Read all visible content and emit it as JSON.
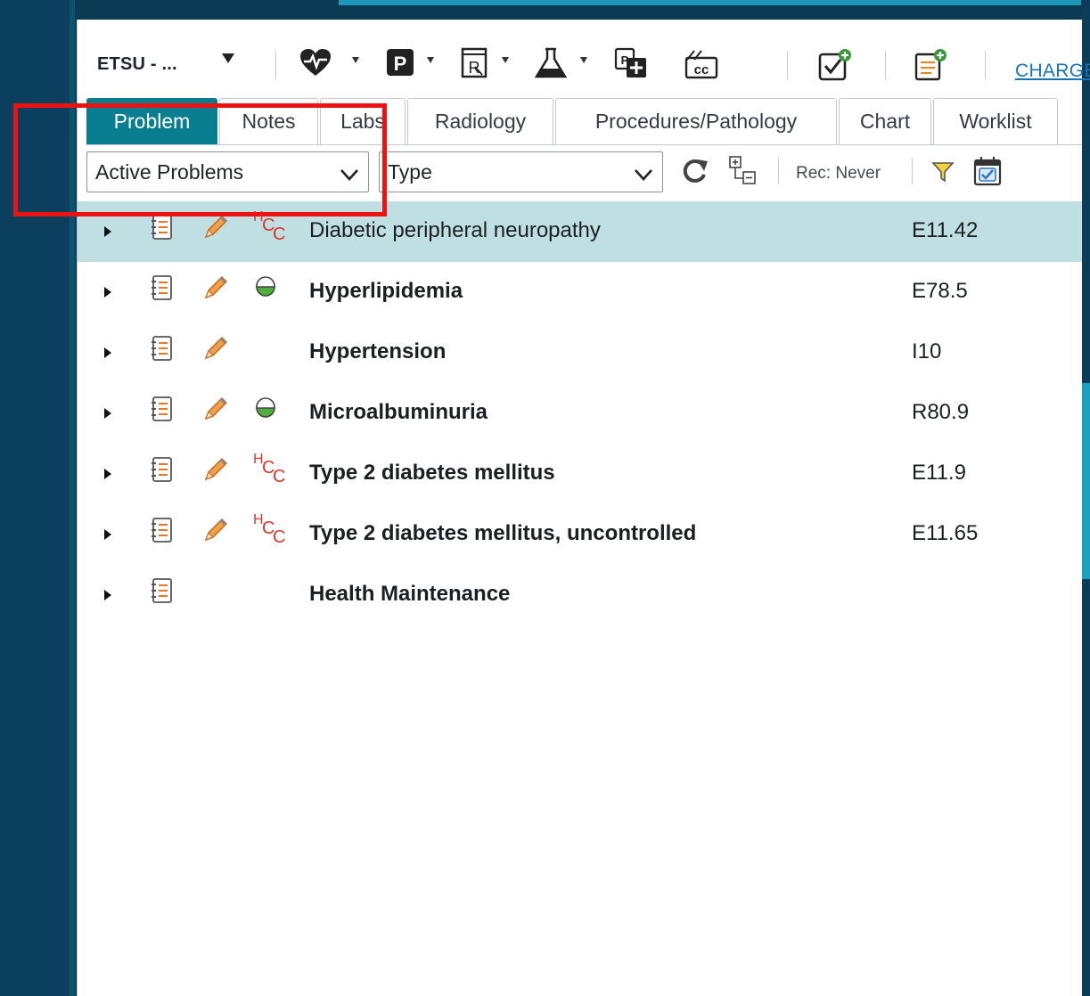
{
  "toolbar": {
    "facility_label": "ETSU - ...",
    "charge_label": "CHARGE",
    "icons": [
      "heart-vitals-icon",
      "p-icon",
      "rx-icon",
      "flask-icon",
      "print-copy-icon",
      "cc-icon",
      "task-check-icon",
      "add-note-icon"
    ]
  },
  "tabs": [
    {
      "label": "Problem",
      "active": true
    },
    {
      "label": "Notes"
    },
    {
      "label": "Labs"
    },
    {
      "label": "Radiology"
    },
    {
      "label": "Procedures/Pathology"
    },
    {
      "label": "Chart"
    },
    {
      "label": "Worklist"
    }
  ],
  "filters": {
    "problem_filter": "Active Problems",
    "type_filter": "Type",
    "rec_label": "Rec: Never"
  },
  "problems": [
    {
      "name": "Diabetic peripheral neuropathy",
      "code": "E11.42",
      "status": "hcc",
      "bold": false,
      "selected": true
    },
    {
      "name": "Hyperlipidemia",
      "code": "E78.5",
      "status": "half-circle",
      "bold": true
    },
    {
      "name": "Hypertension",
      "code": "I10",
      "status": "none",
      "bold": true
    },
    {
      "name": "Microalbuminuria",
      "code": "R80.9",
      "status": "half-circle",
      "bold": true
    },
    {
      "name": "Type 2 diabetes mellitus",
      "code": "E11.9",
      "status": "hcc",
      "bold": true
    },
    {
      "name": "Type 2 diabetes mellitus, uncontrolled",
      "code": "E11.65",
      "status": "hcc",
      "bold": true
    },
    {
      "name": "Health Maintenance",
      "code": "",
      "status": "none",
      "bold": true,
      "no_edit": true
    }
  ],
  "colors": {
    "accent": "#0a7e91",
    "selected_row": "#bfdfe2",
    "hcc": "#d63a2a",
    "highlight": "#ee1111",
    "link": "#1a73b8"
  }
}
